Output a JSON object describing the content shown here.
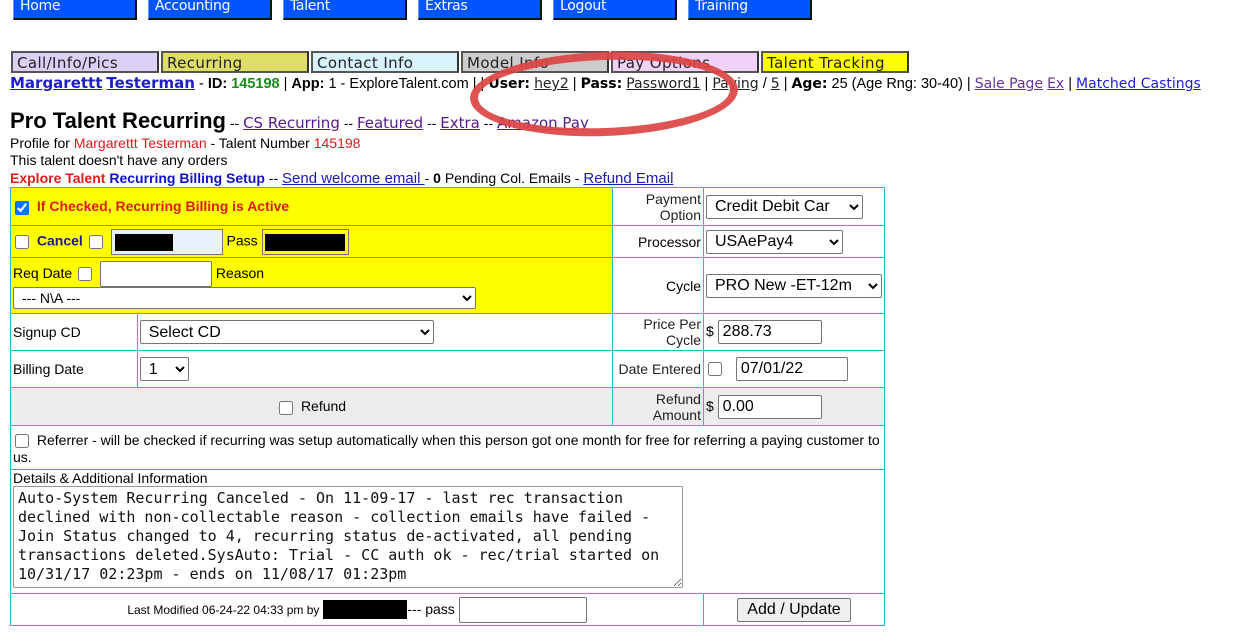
{
  "topnav": [
    "Home",
    "Accounting",
    "Talent",
    "Extras",
    "Logout",
    "Training"
  ],
  "tabs": [
    {
      "label": "Call/Info/Pics",
      "color": "#dcd0f8"
    },
    {
      "label": "Recurring",
      "color": "#dede66"
    },
    {
      "label": "Contact Info",
      "color": "#d8f3fb"
    },
    {
      "label": "Model Info",
      "color": "#cccccc"
    },
    {
      "label": "Pay Options",
      "color": "#f0d2f8"
    },
    {
      "label": "Talent Tracking",
      "color": "#ffff00"
    }
  ],
  "info": {
    "first_name": "Margarettt",
    "last_name": "Testerman",
    "id_label": "ID:",
    "id": "145198",
    "app_label": "App:",
    "app_value": "1 - ExploreTalent.com",
    "user_label": "User:",
    "user": "hey2",
    "pass_label": "Pass:",
    "pass": "Password1",
    "paying": "Paying",
    "paying_num": "5",
    "age_label": "Age:",
    "age_value": "25 (Age Rng: 30-40)",
    "sale_page": "Sale Page",
    "ex": "Ex",
    "matched_castings": "Matched Castings"
  },
  "header": {
    "title": "Pro Talent Recurring",
    "links": [
      "CS Recurring",
      "Featured",
      "Extra",
      "Amazon Pay"
    ],
    "profile_prefix": "Profile for",
    "profile_name": "Margarettt Testerman",
    "talent_number_label": "- Talent Number",
    "talent_number": "145198",
    "no_orders": "This talent doesn't have any orders",
    "setup_red": "Explore Talent",
    "setup_blue": "Recurring Billing Setup",
    "send_welcome": "Send welcome email ",
    "pending_count": "0",
    "pending_text": "Pending Col. Emails -",
    "refund_email": "Refund Email"
  },
  "form": {
    "active_label": "If Checked, Recurring Billing is Active",
    "active_checked": true,
    "cancel_label": "Cancel",
    "pass_label": "Pass",
    "req_date_label": "Req Date",
    "req_date_value": "",
    "reason_label": "Reason",
    "reason_selected": "--- N\\A ---",
    "signup_cd_label": "Signup CD",
    "signup_cd_selected": "Select CD",
    "billing_date_label": "Billing Date",
    "billing_date_selected": "1",
    "refund_label": "Refund",
    "payment_option_label": "Payment Option",
    "payment_option_selected": "Credit Debit Car",
    "processor_label": "Processor",
    "processor_selected": "USAePay4",
    "cycle_label": "Cycle",
    "cycle_selected": "PRO New -ET-12m",
    "price_label": "Price Per Cycle",
    "currency": "$",
    "price_value": "288.73",
    "date_entered_label": "Date Entered",
    "date_entered_value": "07/01/22",
    "refund_amount_label": "Refund Amount",
    "refund_amount_value": "0.00",
    "referrer_text": "Referrer - will be checked if recurring was setup automatically when this person got one month for free for referring a paying customer to us.",
    "details_label": "Details & Additional Information",
    "details_text": "Auto-System Recurring Canceled - On 11-09-17 - last rec transaction declined with non-collectable reason - collection emails have failed - Join Status changed to 4, recurring status de-activated, all pending transactions deleted.SysAuto: Trial - CC auth ok - rec/trial started on 10/31/17 02:23pm - ends on 11/08/17 01:23pm",
    "last_modified": "Last Modified 06-24-22 04:33 pm by",
    "pass_suffix": "--- pass",
    "submit_label": "Add / Update"
  }
}
